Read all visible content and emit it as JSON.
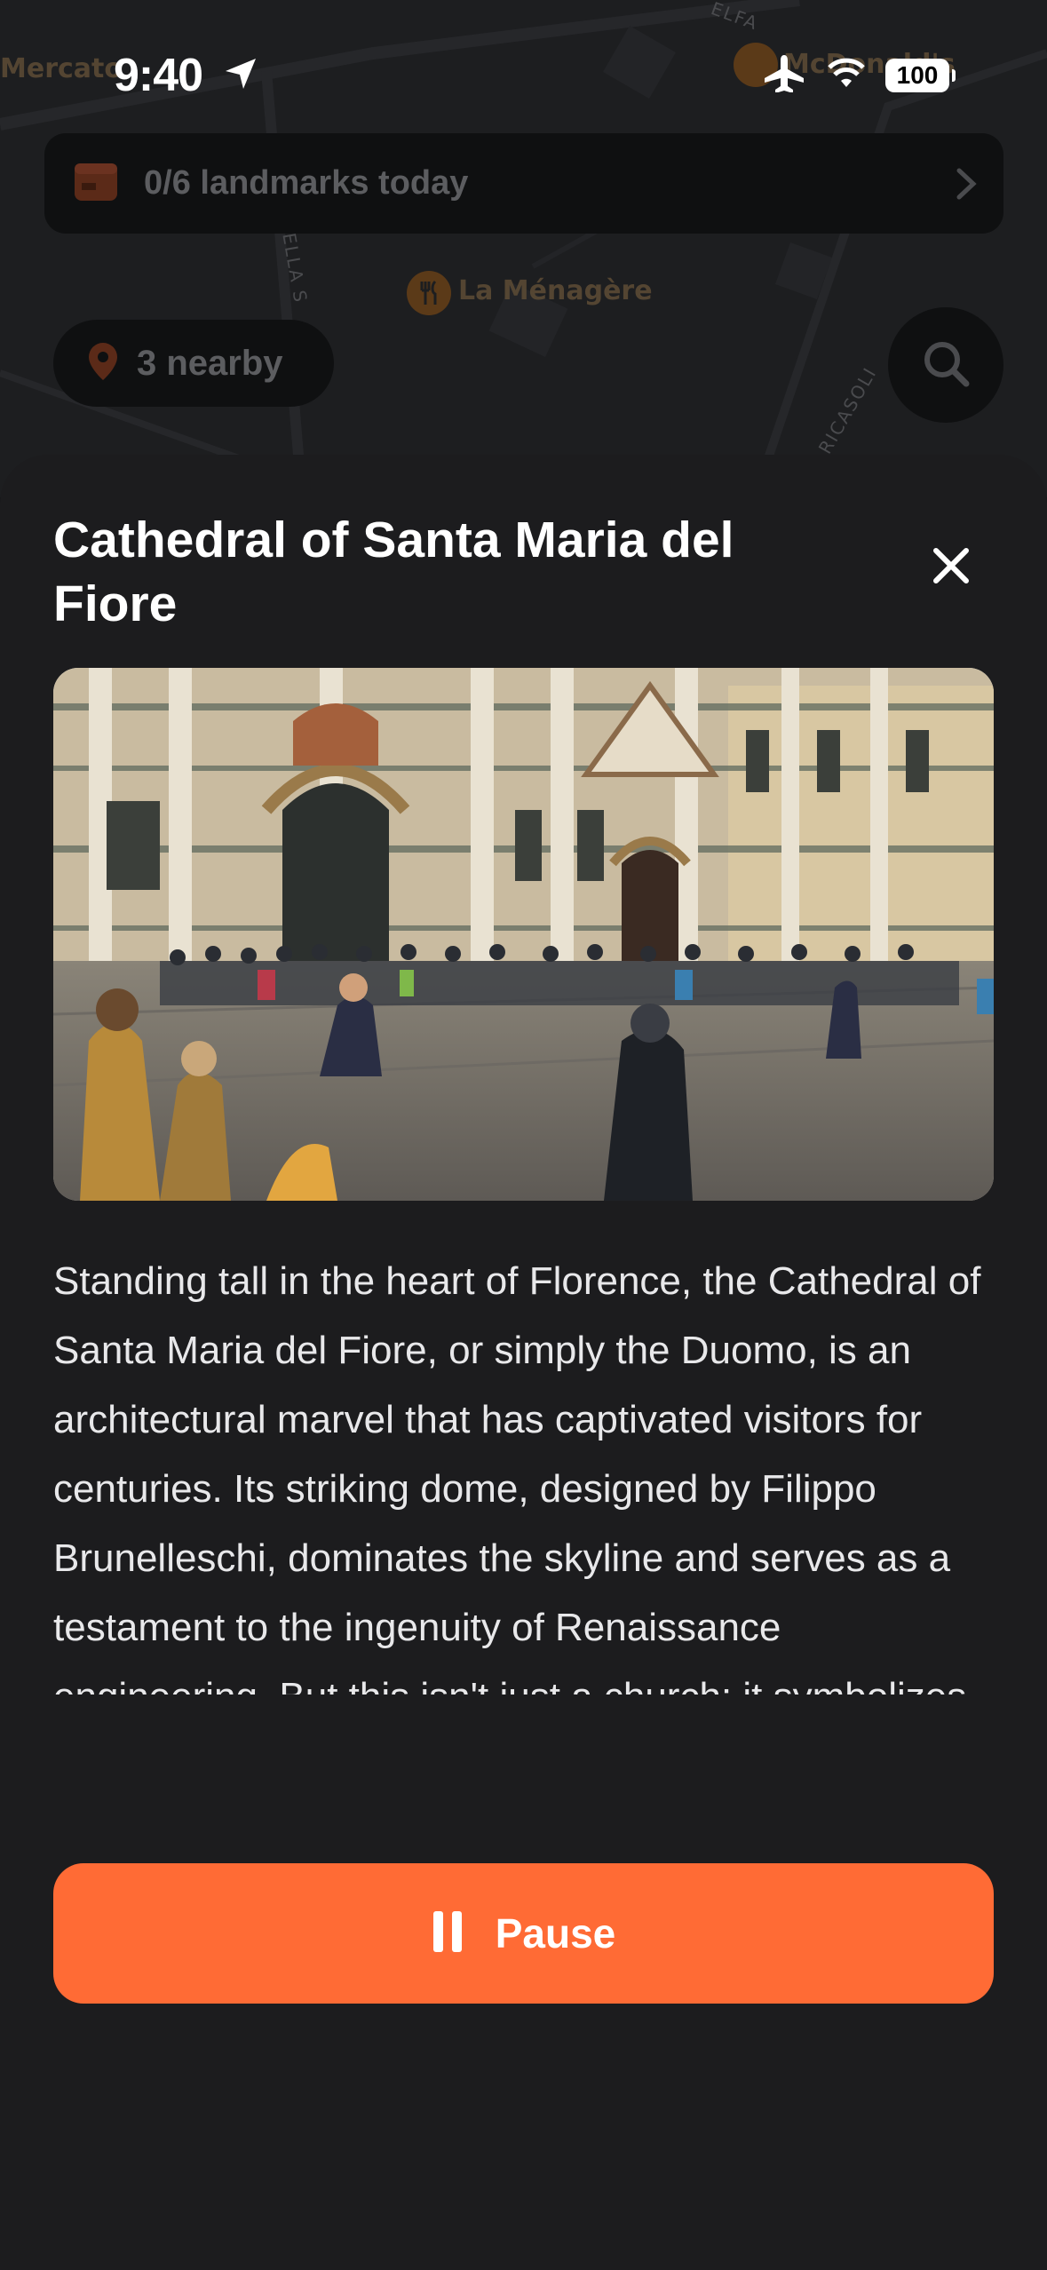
{
  "status_bar": {
    "time": "9:40",
    "battery": "100",
    "icons": [
      "location-arrow-icon",
      "airplane-icon",
      "wifi-icon",
      "battery-icon"
    ]
  },
  "map": {
    "labels": [
      "Mercato",
      "La Ménagère",
      "McDonald's"
    ],
    "street_labels": [
      "ELLA S",
      "RICASOLI",
      "ELFA"
    ],
    "landmarks_banner": "0/6 landmarks today",
    "nearby": "3 nearby"
  },
  "sheet": {
    "title": "Cathedral of Santa Maria del Fiore",
    "description": "Standing tall in the heart of Florence, the Cathedral of Santa Maria del Fiore, or simply the Duomo, is an architectural marvel that has captivated visitors for centuries. Its striking dome, designed by Filippo Brunelleschi, dominates the skyline and serves as a testament to the ingenuity of Renaissance engineering. But this isn't just a church; it symbolizes the city’s",
    "pause_label": "Pause"
  },
  "colors": {
    "accent": "#ff6b35",
    "sheet_bg": "#1c1c1e",
    "map_bg": "#1d1e20"
  }
}
